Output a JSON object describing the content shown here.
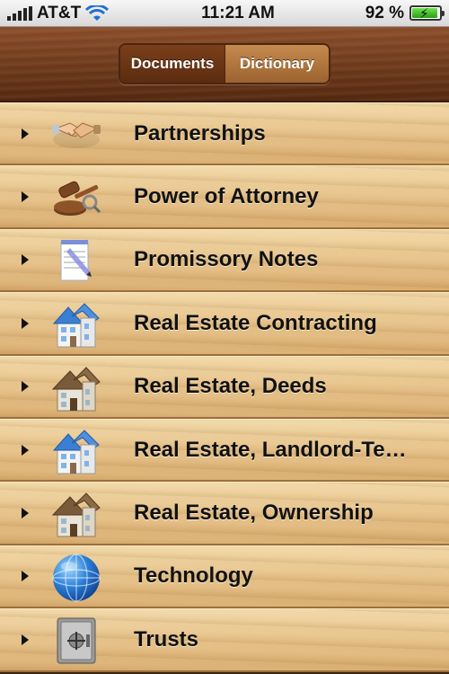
{
  "status_bar": {
    "carrier": "AT&T",
    "time": "11:21 AM",
    "battery_text": "92 %",
    "battery_level": 0.92
  },
  "segmented": {
    "documents_label": "Documents",
    "dictionary_label": "Dictionary",
    "selected": "Documents"
  },
  "items": [
    {
      "label": "Partnerships",
      "icon": "handshake-icon"
    },
    {
      "label": "Power of Attorney",
      "icon": "gavel-icon"
    },
    {
      "label": "Promissory Notes",
      "icon": "notepad-icon"
    },
    {
      "label": "Real Estate Contracting",
      "icon": "blue-house-icon"
    },
    {
      "label": "Real Estate, Deeds",
      "icon": "brown-house-icon"
    },
    {
      "label": "Real Estate, Landlord-Te…",
      "icon": "blue-house-icon"
    },
    {
      "label": "Real Estate, Ownership",
      "icon": "brown-house-icon"
    },
    {
      "label": "Technology",
      "icon": "globe-icon"
    },
    {
      "label": "Trusts",
      "icon": "safe-icon"
    }
  ]
}
